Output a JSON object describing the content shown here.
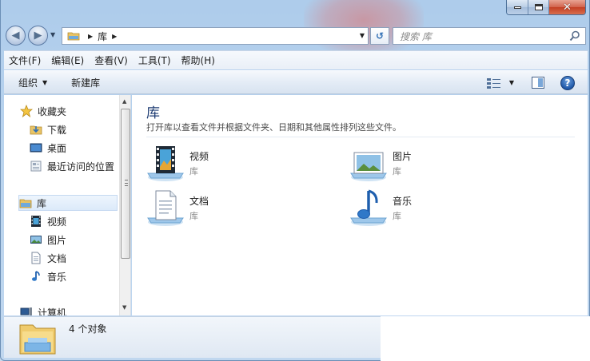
{
  "window": {
    "caption_buttons": {
      "minimize": "minimize-icon",
      "maximize": "maximize-icon",
      "close": "close-icon"
    }
  },
  "address_bar": {
    "path": "库",
    "search_placeholder": "搜索 库"
  },
  "menu": [
    "文件(F)",
    "编辑(E)",
    "查看(V)",
    "工具(T)",
    "帮助(H)"
  ],
  "toolbar": {
    "organize_label": "组织",
    "new_library_label": "新建库"
  },
  "nav_pane": {
    "favorites": "收藏夹",
    "favorites_items": [
      "下载",
      "桌面",
      "最近访问的位置"
    ],
    "libraries": "库",
    "library_items": [
      "视频",
      "图片",
      "文档",
      "音乐"
    ],
    "computer": "计算机"
  },
  "content": {
    "title": "库",
    "description": "打开库以查看文件并根据文件夹、日期和其他属性排列这些文件。",
    "items": [
      {
        "name": "视频",
        "type": "库",
        "icon": "video-library-icon"
      },
      {
        "name": "图片",
        "type": "库",
        "icon": "pictures-library-icon"
      },
      {
        "name": "文档",
        "type": "库",
        "icon": "documents-library-icon"
      },
      {
        "name": "音乐",
        "type": "库",
        "icon": "music-library-icon"
      }
    ]
  },
  "status": {
    "count_text": "4 个对象"
  },
  "colors": {
    "title_blue": "#1e3c73",
    "accent": "#2f6fb5"
  }
}
